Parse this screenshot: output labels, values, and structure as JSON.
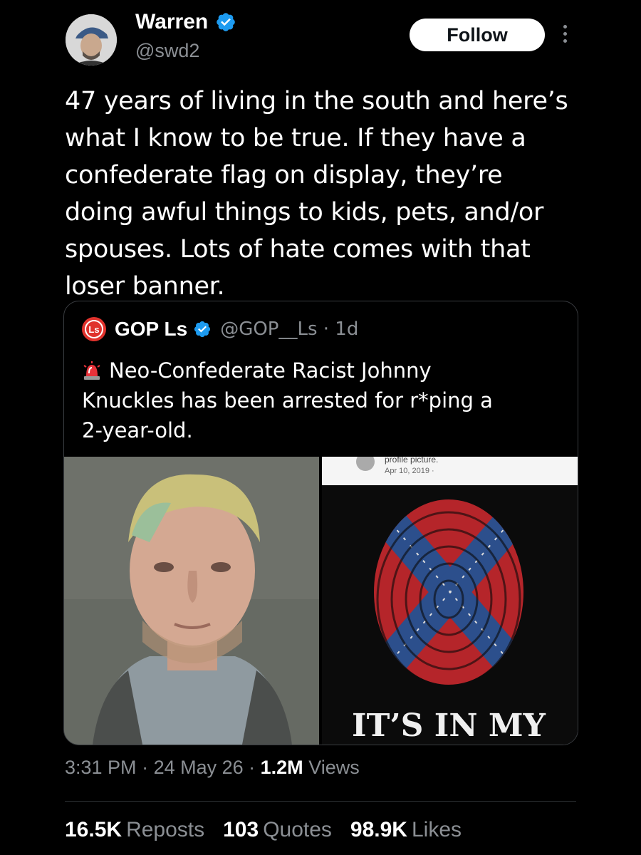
{
  "author": {
    "name": "Warren",
    "handle": "@swd2"
  },
  "follow_label": "Follow",
  "tweet_lines": [
    "47 years of living in the south and here’s",
    "what I know to be true. If they have a",
    "confederate flag on display, they’re",
    "doing awful things to kids, pets, and/or",
    "spouses. Lots of hate comes with that",
    "loser banner."
  ],
  "quote": {
    "name": "GOP Ls",
    "handle_time": "@GOP__Ls · 1d",
    "logo_text": "Ls",
    "lines": [
      "Neo-Confederate Racist Johnny",
      "Knuckles has been arrested for r*ping a",
      "2-year-old."
    ],
    "media_right": {
      "caption": "profile picture.",
      "date": "Apr 10, 2019 ·",
      "slogan": "IT’S IN MY"
    }
  },
  "meta": {
    "time": "3:31 PM",
    "date": "24 May 26",
    "views_count": "1.2M",
    "views_label": "Views"
  },
  "stats": {
    "reposts_count": "16.5K",
    "reposts_label": "Reposts",
    "quotes_count": "103",
    "quotes_label": "Quotes",
    "likes_count": "98.9K",
    "likes_label": "Likes"
  },
  "colors": {
    "background": "#000000",
    "verified": "#1d9bf0",
    "muted": "#8b8f94"
  }
}
